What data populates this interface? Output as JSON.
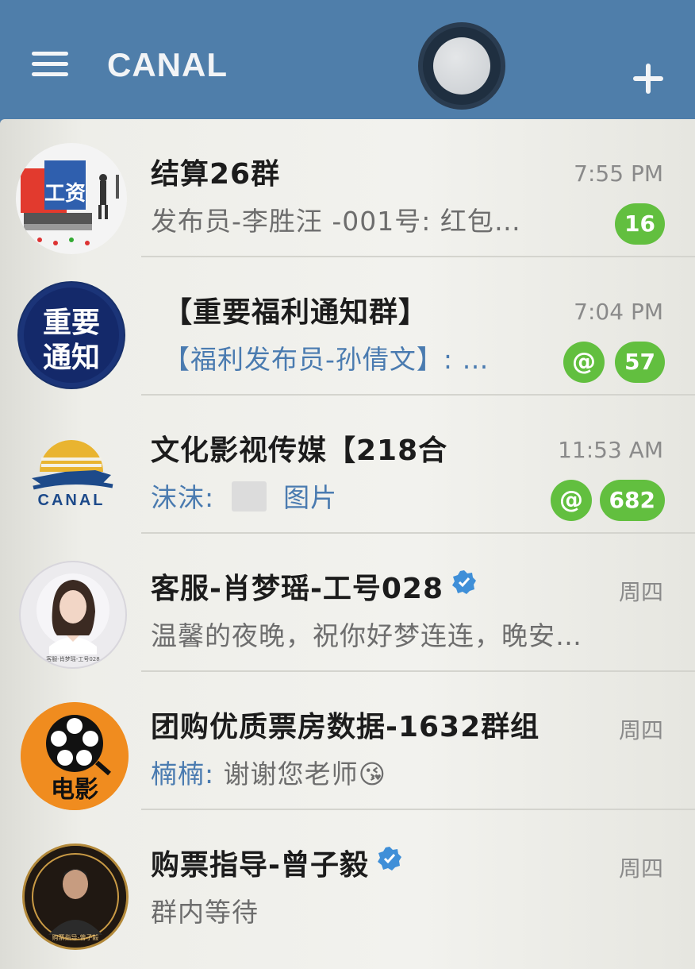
{
  "header": {
    "title": "CANAL"
  },
  "chats": [
    {
      "title": "结算26群",
      "time": "7:55 PM",
      "preview": "发布员-李胜汪 -001号: 红包…",
      "unread": "16",
      "mention": false,
      "avatar_text": "工资"
    },
    {
      "title": "【重要福利通知群】",
      "time": "7:04 PM",
      "preview": "【福利发布员-孙倩文】: …",
      "unread": "57",
      "mention": true,
      "mention_symbol": "@",
      "avatar_text_line1": "重要",
      "avatar_text_line2": "通知"
    },
    {
      "title": "文化影视传媒【218合",
      "time": "11:53 AM",
      "preview_sender": "沫沫:",
      "preview_text": "图片",
      "unread": "682",
      "mention": true,
      "mention_symbol": "@",
      "avatar_text": "CANAL"
    },
    {
      "title": "客服-肖梦瑶-工号028",
      "time": "周四",
      "preview": "温馨的夜晚，祝你好梦连连，晚安…",
      "verified": true,
      "avatar_caption": "客服-肖梦瑶-工号028"
    },
    {
      "title": "团购优质票房数据-1632群组",
      "time": "周四",
      "preview_sender": "楠楠:",
      "preview_text": "谢谢您老师",
      "preview_emoji": "😘",
      "avatar_text": "电影"
    },
    {
      "title": "购票指导-曾子毅",
      "time": "周四",
      "preview": "群内等待",
      "verified": true,
      "avatar_caption": "购票指导-曾子毅"
    }
  ],
  "colors": {
    "header": "#4f7eaa",
    "badge": "#62bf3f",
    "sender": "#4a7bb0",
    "verified": "#3f8fd8"
  }
}
